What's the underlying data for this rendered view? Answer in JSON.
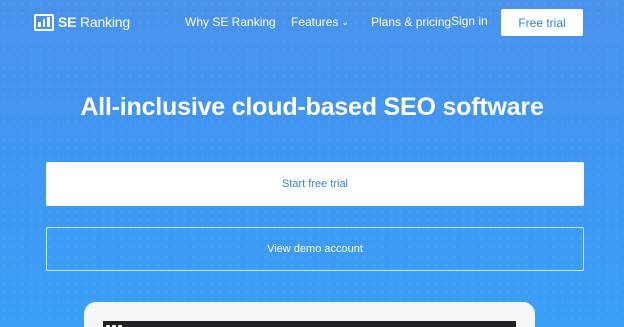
{
  "brand": {
    "name_prefix": "SE",
    "name_suffix": " Ranking",
    "logo_icon": "bar-chart-logo-icon",
    "accent_color": "#3f96f2",
    "button_text_color": "#2f80e4"
  },
  "nav": {
    "why": "Why SE Ranking",
    "features": "Features",
    "features_icon": "chevron-down-icon",
    "plans": "Plans & pricing",
    "sign_in": "Sign in",
    "free_trial": "Free trial"
  },
  "hero": {
    "headline": "All-inclusive cloud-based SEO software",
    "primary_cta": "Start free trial",
    "secondary_cta": "View demo account"
  }
}
